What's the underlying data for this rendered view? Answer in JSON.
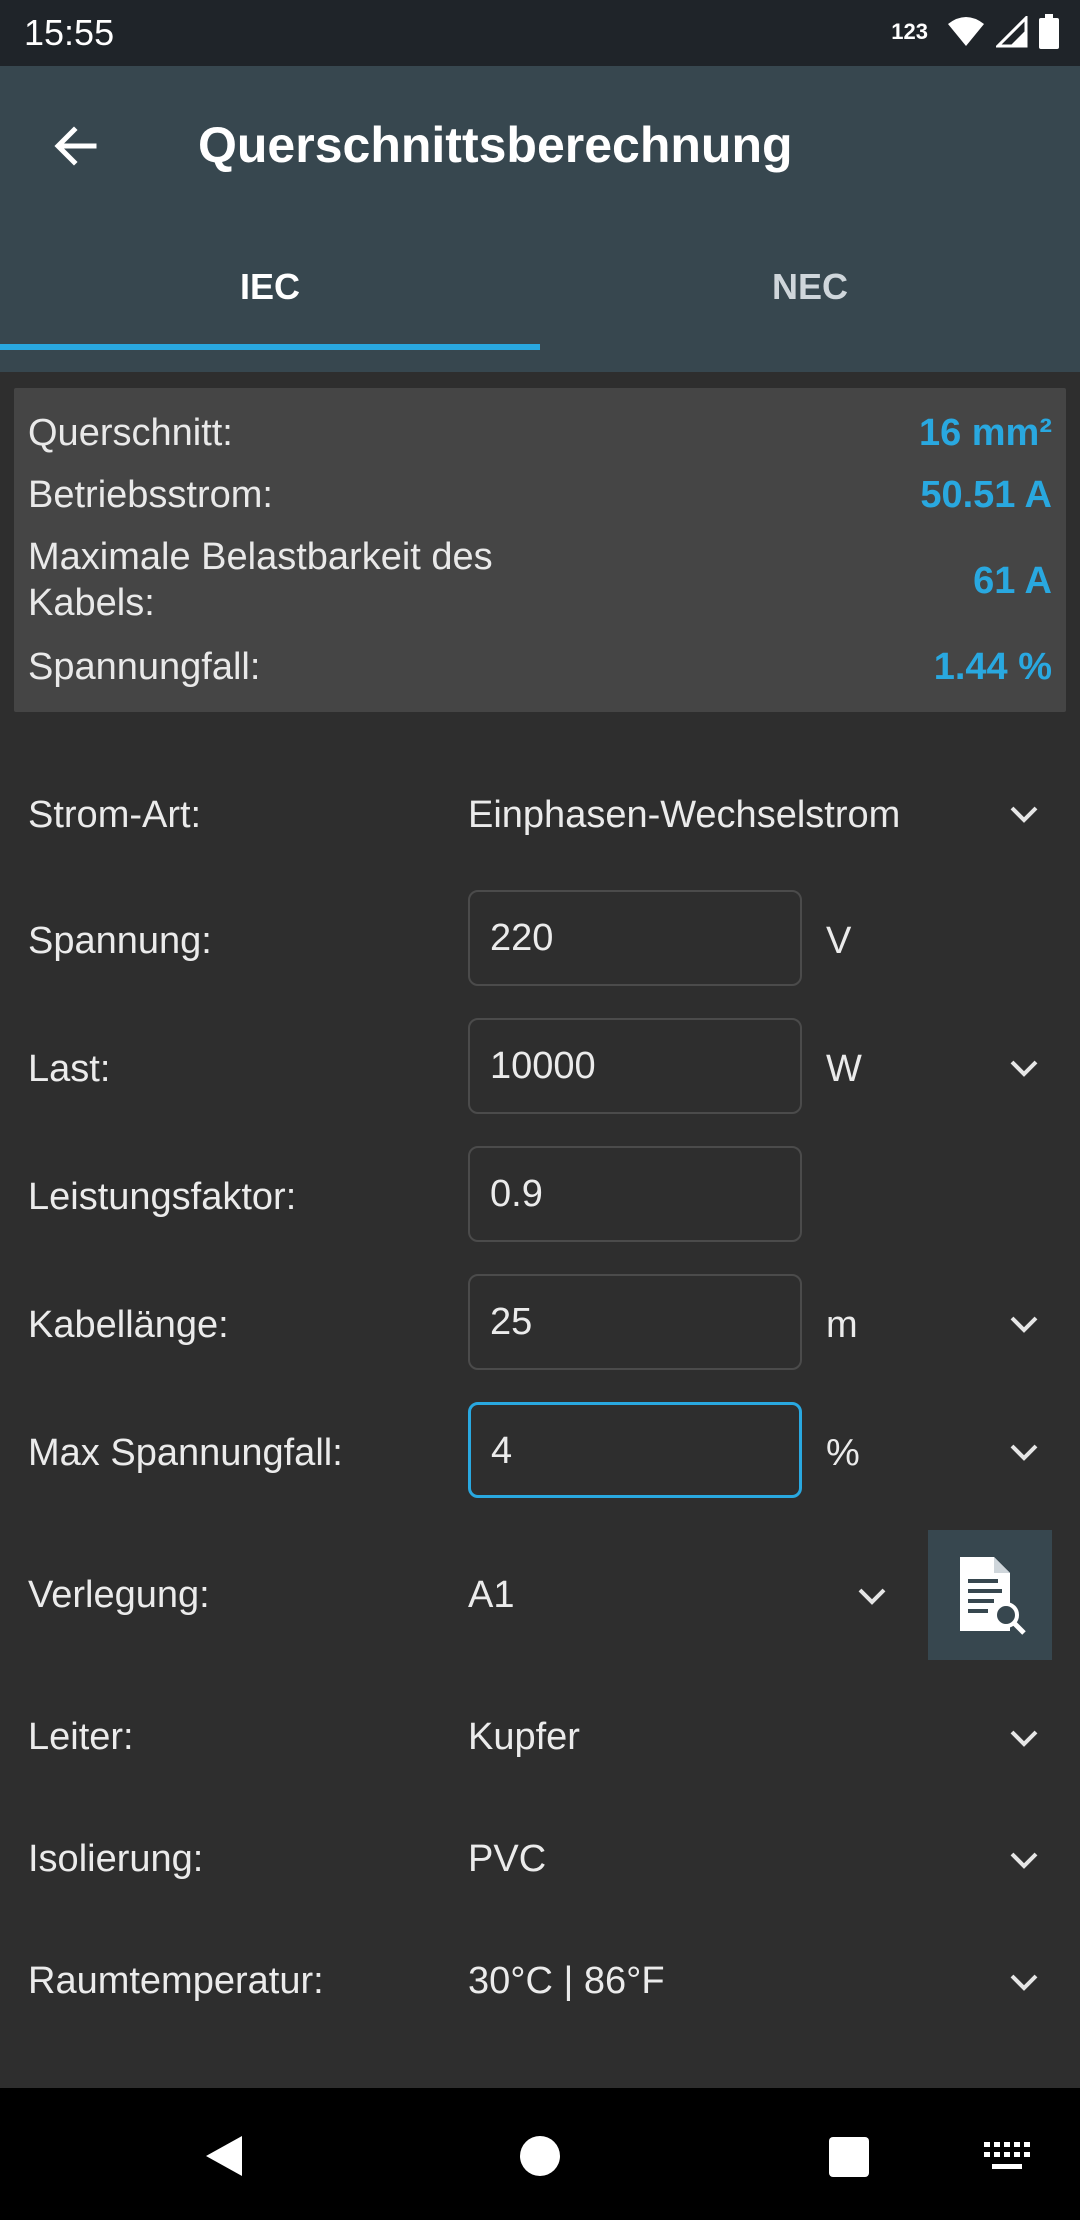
{
  "status_bar": {
    "time": "15:55",
    "input_mode": "123"
  },
  "app_bar": {
    "title": "Querschnittsberechnung"
  },
  "tabs": [
    {
      "label": "IEC",
      "selected": true
    },
    {
      "label": "NEC",
      "selected": false
    }
  ],
  "results": [
    {
      "label": "Querschnitt:",
      "value": "16 mm²"
    },
    {
      "label": "Betriebsstrom:",
      "value": "50.51 A"
    },
    {
      "label": "Maximale Belastbarkeit des Kabels:",
      "value": "61 A"
    },
    {
      "label": "Spannungfall:",
      "value": "1.44 %"
    }
  ],
  "form": {
    "current_type": {
      "label": "Strom-Art:",
      "value": "Einphasen-Wechselstrom"
    },
    "voltage": {
      "label": "Spannung:",
      "value": "220",
      "unit": "V"
    },
    "load": {
      "label": "Last:",
      "value": "10000",
      "unit": "W"
    },
    "power_factor": {
      "label": "Leistungsfaktor:",
      "value": "0.9"
    },
    "cable_length": {
      "label": "Kabellänge:",
      "value": "25",
      "unit": "m"
    },
    "max_voltage_drop": {
      "label": "Max Spannungfall:",
      "value": "4",
      "unit": "%"
    },
    "installation": {
      "label": "Verlegung:",
      "value": "A1"
    },
    "conductor": {
      "label": "Leiter:",
      "value": "Kupfer"
    },
    "insulation": {
      "label": "Isolierung:",
      "value": "PVC"
    },
    "ambient_temp": {
      "label": "Raumtemperatur:",
      "value": "30°C | 86°F"
    }
  },
  "colors": {
    "accent": "#29a8e0",
    "appbar": "#37474f",
    "background": "#2e2e2e",
    "panel": "#454545"
  },
  "icons": [
    "back-arrow-icon",
    "wifi-icon",
    "signal-icon",
    "battery-icon",
    "chevron-down-icon",
    "document-search-icon",
    "nav-back-icon",
    "nav-home-icon",
    "nav-recents-icon",
    "keyboard-icon"
  ]
}
